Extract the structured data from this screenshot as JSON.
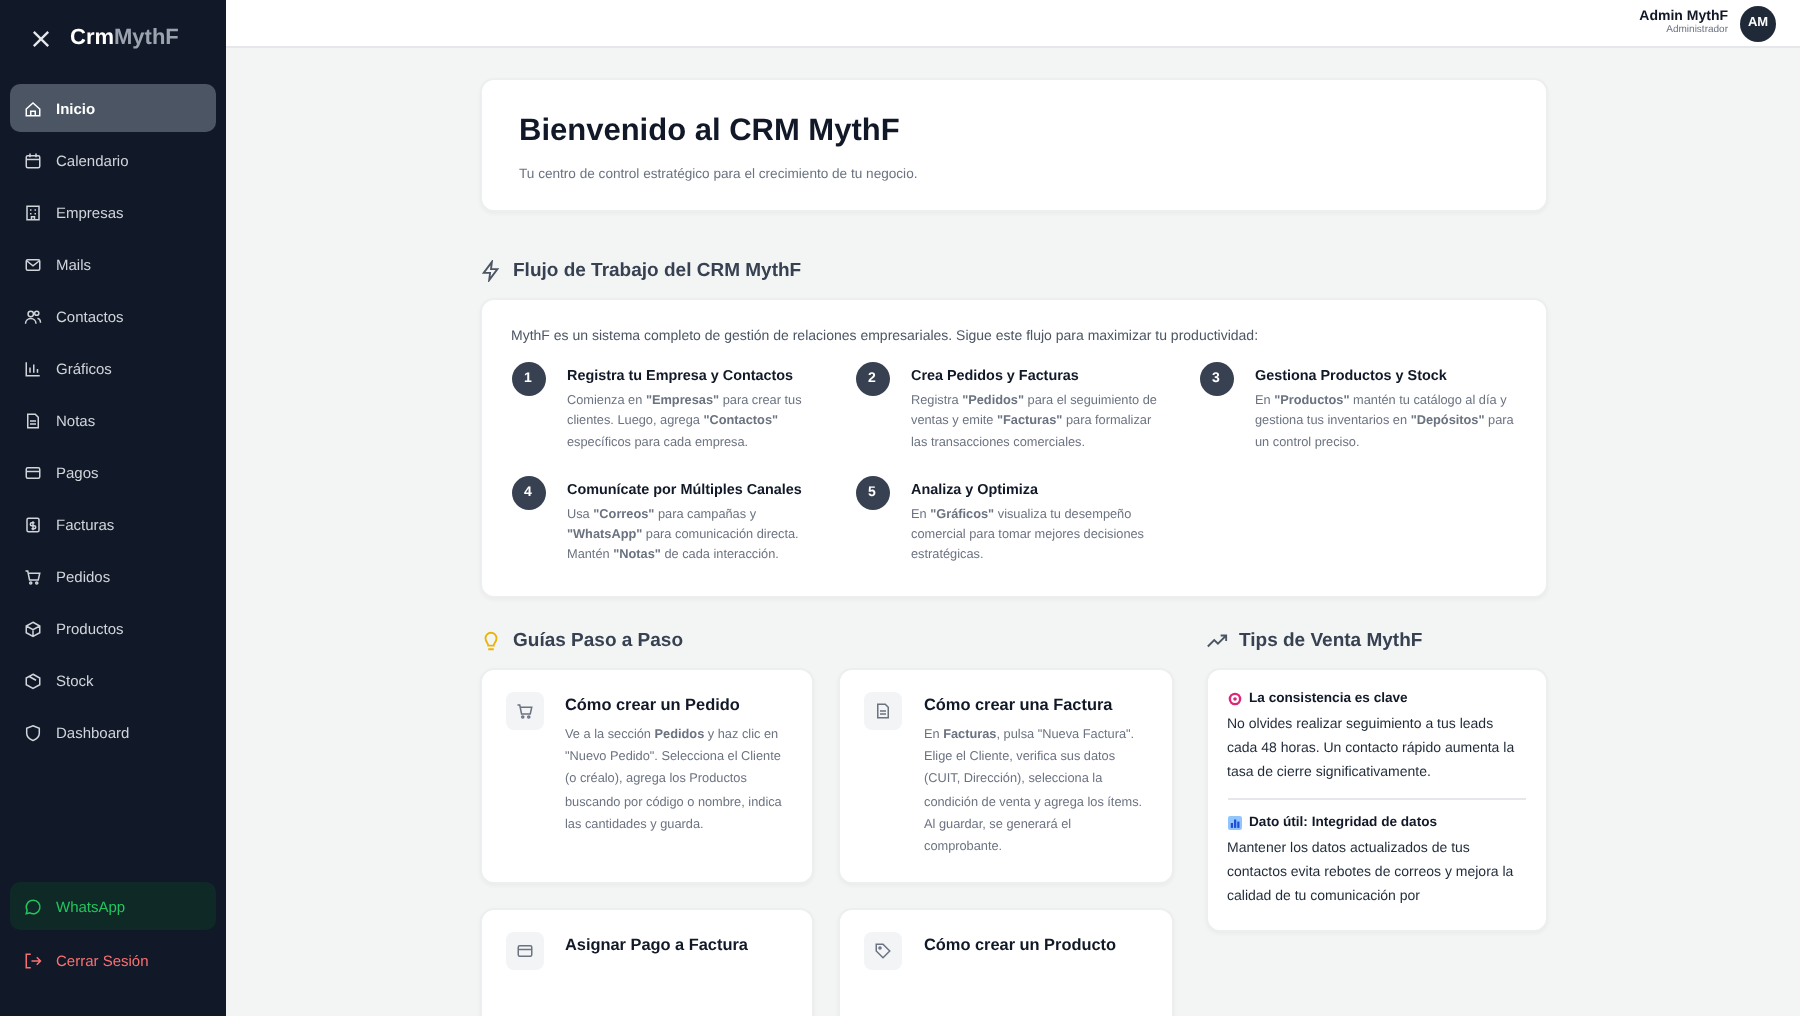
{
  "sidebar": {
    "logo": {
      "part_1": "Crm",
      "part_2": "MythF"
    },
    "items": [
      {
        "label": "Inicio",
        "selected": true
      },
      {
        "label": "Calendario",
        "selected": false
      },
      {
        "label": "Empresas",
        "selected": false
      },
      {
        "label": "Mails",
        "selected": false
      },
      {
        "label": "Contactos",
        "selected": false
      },
      {
        "label": "Gráficos",
        "selected": false
      },
      {
        "label": "Notas",
        "selected": false
      },
      {
        "label": "Pagos",
        "selected": false
      },
      {
        "label": "Facturas",
        "selected": false
      },
      {
        "label": "Pedidos",
        "selected": false
      },
      {
        "label": "Productos",
        "selected": false
      },
      {
        "label": "Stock",
        "selected": false
      },
      {
        "label": "Dashboard",
        "selected": false
      }
    ],
    "whatsapp": "WhatsApp",
    "logout": "Cerrar Sesión"
  },
  "header": {
    "user_name": "Admin MythF",
    "user_role": "Administrador",
    "avatar": "AM"
  },
  "welcome": {
    "title": "Bienvenido al CRM MythF",
    "subtitle": "Tu centro de control estratégico para el crecimiento de tu negocio."
  },
  "workflow": {
    "heading": "Flujo de Trabajo del CRM MythF",
    "intro": "MythF es un sistema completo de gestión de relaciones empresariales. Sigue este flujo para maximizar tu productividad:",
    "steps": [
      {
        "number": "1",
        "title": "Registra tu Empresa y Contactos",
        "text": "Comienza en **\"Empresas\"** para crear tus clientes. Luego, agrega **\"Contactos\"** específicos para cada empresa."
      },
      {
        "number": "2",
        "title": "Crea Pedidos y Facturas",
        "text": "Registra **\"Pedidos\"** para el seguimiento de ventas y emite **\"Facturas\"** para formalizar las transacciones comerciales."
      },
      {
        "number": "3",
        "title": "Gestiona Productos y Stock",
        "text": "En **\"Productos\"** mantén tu catálogo al día y gestiona tus inventarios en **\"Depósitos\"** para un control preciso."
      },
      {
        "number": "4",
        "title": "Comunícate por Múltiples Canales",
        "text": "Usa **\"Correos\"** para campañas y **\"WhatsApp\"** para comunicación directa. Mantén **\"Notas\"** de cada interacción."
      },
      {
        "number": "5",
        "title": "Analiza y Optimiza",
        "text": "En **\"Gráficos\"** visualiza tu desempeño comercial para tomar mejores decisiones estratégicas."
      }
    ]
  },
  "guides": {
    "heading": "Guías Paso a Paso",
    "cards": [
      {
        "title": "Cómo crear un Pedido",
        "text": "Ve a la sección **Pedidos** y haz clic en \"Nuevo Pedido\". Selecciona el Cliente (o créalo), agrega los Productos buscando por código o nombre, indica las cantidades y guarda."
      },
      {
        "title": "Cómo crear una Factura",
        "text": "En **Facturas**, pulsa \"Nueva Factura\". Elige el Cliente, verifica sus datos (CUIT, Dirección), selecciona la condición de venta y agrega los ítems. Al guardar, se generará el comprobante."
      },
      {
        "title": "Asignar Pago a Factura"
      },
      {
        "title": "Cómo crear un Producto"
      }
    ]
  },
  "tips": {
    "heading": "Tips de Venta MythF",
    "items": [
      {
        "title": "La consistencia es clave",
        "text": "No olvides realizar seguimiento a tus leads cada 48 horas. Un contacto rápido aumenta la tasa de cierre significativamente."
      },
      {
        "title": "Dato útil: Integridad de datos",
        "text": "Mantener los datos actualizados de tus contactos evita rebotes de correos y mejora la calidad de tu comunicación por"
      }
    ]
  }
}
